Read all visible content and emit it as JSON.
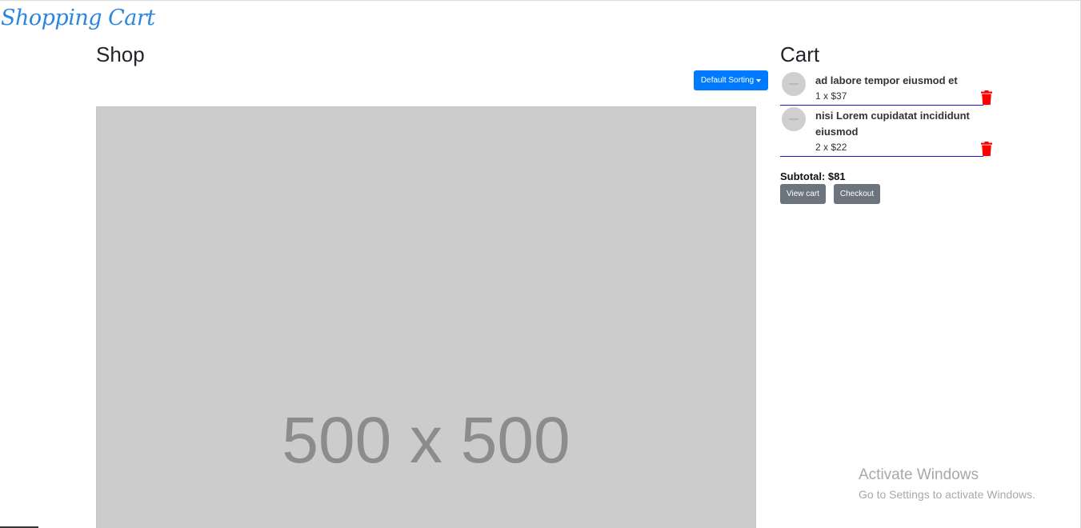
{
  "brand": "Shopping Cart",
  "shop": {
    "title": "Shop",
    "sort_label": "Default Sorting",
    "product_image_text": "500 x 500"
  },
  "cart": {
    "title": "Cart",
    "items": [
      {
        "name": "ad labore tempor eiusmod et",
        "qty_price": "1 x $37"
      },
      {
        "name": "nisi Lorem cupidatat incididunt eiusmod",
        "qty_price": "2 x $22"
      }
    ],
    "subtotal": "Subtotal: $81",
    "view_cart_label": "View cart",
    "checkout_label": "Checkout"
  },
  "watermark": {
    "line1": "Activate Windows",
    "line2": "Go to Settings to activate Windows."
  },
  "colors": {
    "brand": "#2a86e0",
    "primary": "#007bff",
    "secondary": "#6c757d",
    "danger": "#ff0000"
  }
}
